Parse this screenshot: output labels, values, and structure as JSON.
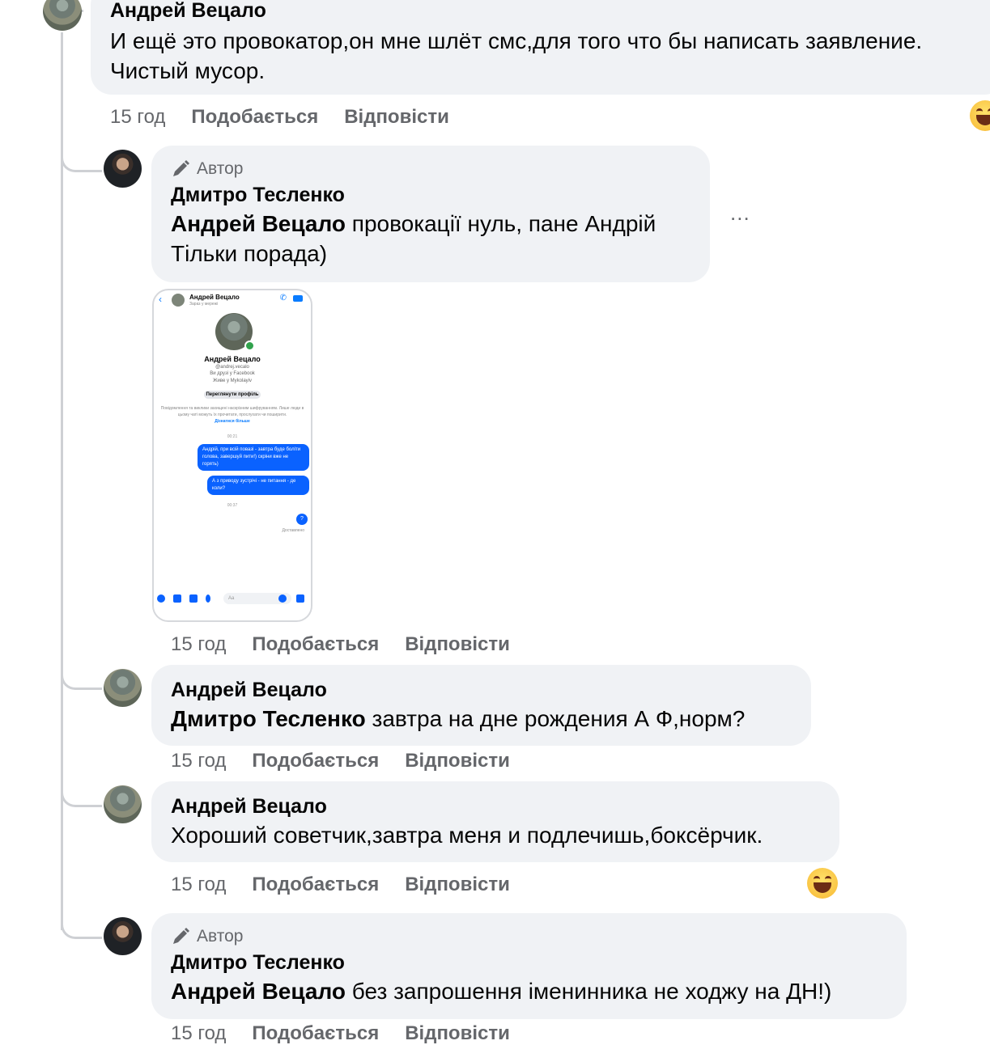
{
  "comments": [
    {
      "author": "Андрей Вецало",
      "text": "И ещё это провокатор,он мне шлёт смс,для того что бы написать заявление. Чистый мусор.",
      "time": "15 год",
      "like": "Подобається",
      "reply": "Відповісти"
    },
    {
      "badge": "Автор",
      "author": "Дмитро Тесленко",
      "mention": "Андрей Вецало",
      "text": " провокації нуль, пане Андрій Тільки порада)",
      "more": "...",
      "time": "15 год",
      "like": "Подобається",
      "reply": "Відповісти"
    },
    {
      "author": "Андрей Вецало",
      "mention": "Дмитро Тесленко",
      "text": " завтра на дне рождения А Ф,норм?",
      "time": "15 год",
      "like": "Подобається",
      "reply": "Відповісти"
    },
    {
      "author": "Андрей Вецало",
      "text": "Хороший советчик,завтра меня и подлечишь,боксёрчик.",
      "time": "15 год",
      "like": "Подобається",
      "reply": "Відповісти"
    },
    {
      "badge": "Автор",
      "author": "Дмитро Тесленко",
      "mention": "Андрей Вецало",
      "text": " без запрошення іменинника не ходжу на ДН!)",
      "time": "15 год",
      "like": "Подобається",
      "reply": "Відповісти"
    }
  ],
  "attachment": {
    "header_name": "Андрей Вецало",
    "header_sub": "Зараз у мережі",
    "profile_name": "Андрей Вецало",
    "handle": "@andrej.vecalo",
    "friends": "Ви друзі у Facebook",
    "lives": "Живе у Mykolayiv",
    "view_profile": "Переглянути профіль",
    "note": "Повідомлення та виклики захищені наскрізним шифруванням. Лише люди в цьому чаті можуть їх прочитати, прослухати чи поширити.",
    "learn_more": "Дізнатися більше",
    "time1": "00:21",
    "msg1": "Андрій, при всій повазі - завтра буде боліти голова, завершуй пити!) скріни вже не горять)",
    "msg2": "А з приводу зустрічі - не питання - де коли?",
    "time2": "00:37",
    "msg3": "?",
    "delivered": "Доставлено",
    "input_placeholder": "Aa"
  }
}
